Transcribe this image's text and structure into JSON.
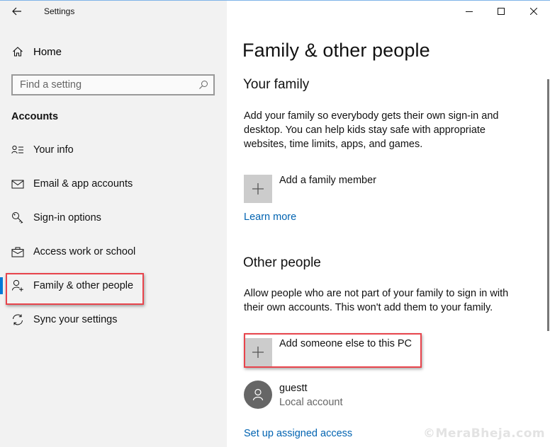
{
  "window": {
    "title": "Settings",
    "controls": {
      "minimize": "minimize-icon",
      "maximize": "maximize-icon",
      "close": "close-icon"
    }
  },
  "sidebar": {
    "back_icon": "back-arrow-icon",
    "home_label": "Home",
    "search_placeholder": "Find a setting",
    "section_header": "Accounts",
    "items": [
      {
        "label": "Your info",
        "icon": "person-list-icon",
        "active": false
      },
      {
        "label": "Email & app accounts",
        "icon": "mail-icon",
        "active": false
      },
      {
        "label": "Sign-in options",
        "icon": "key-icon",
        "active": false
      },
      {
        "label": "Access work or school",
        "icon": "briefcase-icon",
        "active": false
      },
      {
        "label": "Family & other people",
        "icon": "person-add-icon",
        "active": true
      },
      {
        "label": "Sync your settings",
        "icon": "sync-icon",
        "active": false
      }
    ]
  },
  "main": {
    "page_title": "Family & other people",
    "your_family": {
      "heading": "Your family",
      "description": "Add your family so everybody gets their own sign-in and desktop. You can help kids stay safe with appropriate websites, time limits, apps, and games.",
      "add_label": "Add a family member",
      "learn_more": "Learn more"
    },
    "other_people": {
      "heading": "Other people",
      "description": "Allow people who are not part of your family to sign in with their own accounts. This won't add them to your family.",
      "add_label": "Add someone else to this PC",
      "users": [
        {
          "name": "guestt",
          "type": "Local account"
        }
      ],
      "assigned_access": "Set up assigned access"
    }
  },
  "watermark": "©MeraBheja.com",
  "colors": {
    "accent": "#0078d7",
    "link": "#0063b1",
    "highlight": "#e8444c",
    "sidebar_bg": "#f2f2f2"
  }
}
